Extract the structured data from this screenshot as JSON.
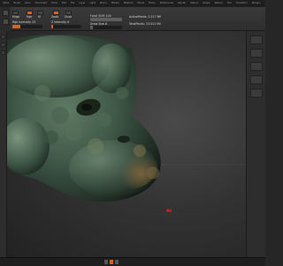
{
  "menu": {
    "items": [
      "Alpha",
      "Brush",
      "Color",
      "Document",
      "Draw",
      "Edit",
      "File",
      "Layer",
      "Light",
      "Macro",
      "Marker",
      "Material",
      "Movie",
      "Picker",
      "Preferences",
      "Render",
      "Stencil",
      "Stroke",
      "Texture",
      "Tool",
      "Transform",
      "Zplugin",
      "Zscript"
    ]
  },
  "toolbar": {
    "mrgb_label": "Mrgb",
    "rgb_label": "Rgb",
    "m_label": "M",
    "zadd_label": "Zadd",
    "zsub_label": "Zsub",
    "rgb_intensity_label": "Rgb Intensity 25",
    "z_intensity_label": "Z Intensity 6",
    "focal_shift_label": "Focal Shift 100",
    "draw_size_label": "Draw Size 8",
    "active_points_label": "ActivePoints: 2.217 Mil",
    "total_points_label": "TotalPoints: 23.021 Mil",
    "rgb_intensity": 0.25,
    "z_intensity": 0.06,
    "focal_shift": 1.0,
    "draw_size": 0.08,
    "accent_color": "#e0621a"
  },
  "canvas": {
    "model_name": "dragon-head-sculpt",
    "marker_color": "#b42424"
  }
}
